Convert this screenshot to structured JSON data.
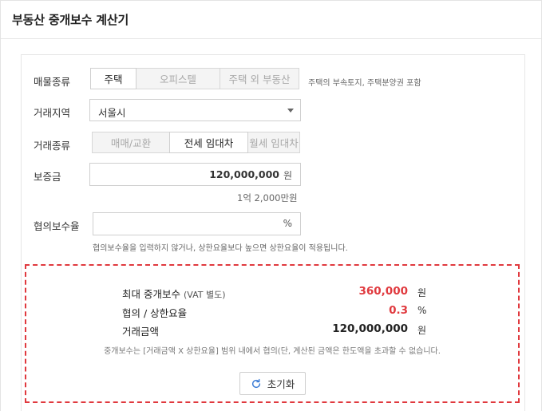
{
  "header": {
    "title": "부동산 중개보수 계산기"
  },
  "property_type": {
    "label": "매물종류",
    "options": [
      "주택",
      "오피스텔",
      "주택 외 부동산"
    ],
    "selected": "주택",
    "hint": "주택의 부속토지, 주택분양권 포함"
  },
  "region": {
    "label": "거래지역",
    "value": "서울시"
  },
  "transaction_type": {
    "label": "거래종류",
    "options": [
      "매매/교환",
      "전세 임대차",
      "월세 임대차"
    ],
    "selected": "전세 임대차"
  },
  "deposit": {
    "label": "보증금",
    "value": "120,000,000",
    "unit": "원",
    "korean": "1억 2,000만원"
  },
  "agreed_rate": {
    "label": "협의보수율",
    "value": "",
    "unit": "%",
    "help": "협의보수율을 입력하지 않거나, 상한요율보다 높으면 상한요율이 적용됩니다."
  },
  "result": {
    "max_fee_label": "최대 중개보수",
    "max_fee_note": "(VAT 별도)",
    "max_fee_value": "360,000",
    "max_fee_unit": "원",
    "rate_label": "협의 / 상한요율",
    "rate_value": "0.3",
    "rate_unit": "%",
    "amount_label": "거래금액",
    "amount_value": "120,000,000",
    "amount_unit": "원",
    "note": "중개보수는 [거래금액 X 상한요율] 범위 내에서 협의(단, 계산된 금액은 한도액을 초과할 수 없습니다.",
    "reset_label": "초기화"
  },
  "colors": {
    "accent_red": "#e0393e",
    "border": "#cfcfcf"
  }
}
